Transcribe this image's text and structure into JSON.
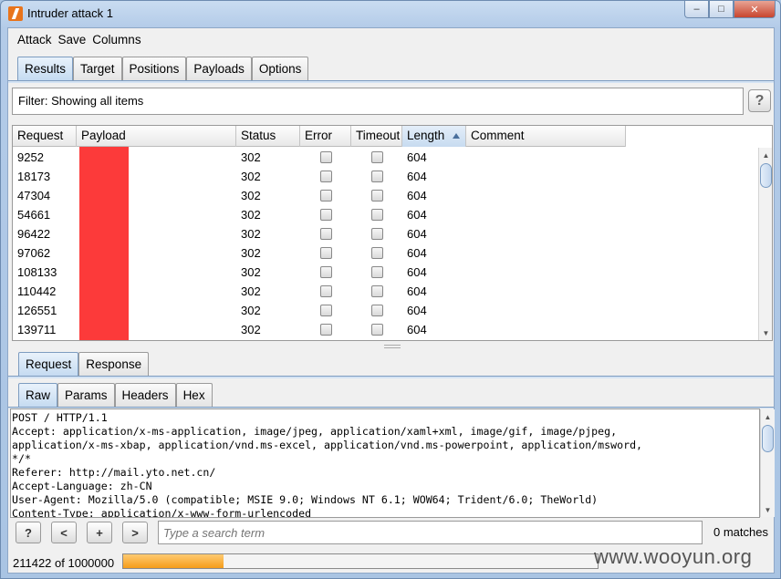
{
  "window": {
    "title": "Intruder attack 1"
  },
  "menu": {
    "items": [
      "Attack",
      "Save",
      "Columns"
    ]
  },
  "main_tabs": [
    "Results",
    "Target",
    "Positions",
    "Payloads",
    "Options"
  ],
  "filter": {
    "text": "Filter: Showing all items",
    "help_label": "?"
  },
  "table": {
    "columns": [
      "Request",
      "Payload",
      "Status",
      "Error",
      "Timeout",
      "Length",
      "Comment"
    ],
    "sorted_column": "Length",
    "rows": [
      {
        "request": "9252",
        "status": "302",
        "length": "604"
      },
      {
        "request": "18173",
        "status": "302",
        "length": "604"
      },
      {
        "request": "47304",
        "status": "302",
        "length": "604"
      },
      {
        "request": "54661",
        "status": "302",
        "length": "604"
      },
      {
        "request": "96422",
        "status": "302",
        "length": "604"
      },
      {
        "request": "97062",
        "status": "302",
        "length": "604"
      },
      {
        "request": "108133",
        "status": "302",
        "length": "604"
      },
      {
        "request": "110442",
        "status": "302",
        "length": "604"
      },
      {
        "request": "126551",
        "status": "302",
        "length": "604"
      },
      {
        "request": "139711",
        "status": "302",
        "length": "604"
      }
    ]
  },
  "detail_tabs": [
    "Request",
    "Response"
  ],
  "view_tabs": [
    "Raw",
    "Params",
    "Headers",
    "Hex"
  ],
  "raw_request": "POST / HTTP/1.1\nAccept: application/x-ms-application, image/jpeg, application/xaml+xml, image/gif, image/pjpeg,\napplication/x-ms-xbap, application/vnd.ms-excel, application/vnd.ms-powerpoint, application/msword,\n*/*\nReferer: http://mail.yto.net.cn/\nAccept-Language: zh-CN\nUser-Agent: Mozilla/5.0 (compatible; MSIE 9.0; Windows NT 6.1; WOW64; Trident/6.0; TheWorld)\nContent-Type: application/x-www-form-urlencoded",
  "search": {
    "help_label": "?",
    "prev_label": "<",
    "add_label": "+",
    "next_label": ">",
    "placeholder": "Type a search term",
    "matches": "0 matches"
  },
  "progress": {
    "text": "211422 of 1000000",
    "fraction": 0.211422
  },
  "watermark": "www.wooyun.org",
  "colors": {
    "accent_tab": "#c5dbf1",
    "progress": "#f59c1a",
    "redaction": "#fc3a3a"
  }
}
